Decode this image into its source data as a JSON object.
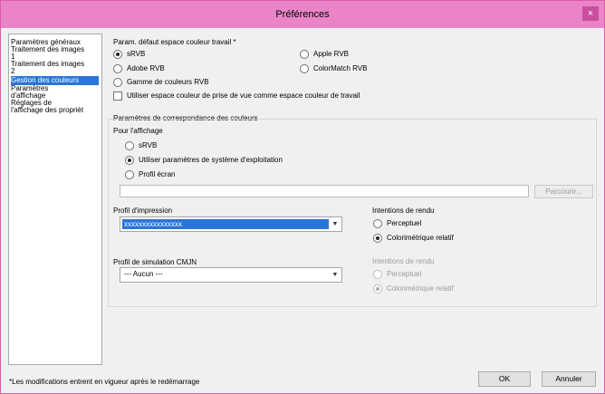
{
  "window": {
    "title": "Préférences",
    "close_glyph": "×"
  },
  "sidebar": {
    "items": [
      {
        "label": "Paramètres généraux",
        "selected": false
      },
      {
        "label": "Traitement des images",
        "selected": false
      },
      {
        "label": "1",
        "selected": false
      },
      {
        "label": "Traitement des images",
        "selected": false
      },
      {
        "label": "2",
        "selected": false
      },
      {
        "label": "Gestion des couleurs",
        "selected": true
      },
      {
        "label": "Paramètres",
        "selected": false
      },
      {
        "label": "d'affichage",
        "selected": false
      },
      {
        "label": "Réglages de",
        "selected": false
      },
      {
        "label": "l'affichage des propriét",
        "selected": false
      }
    ]
  },
  "workspace": {
    "title": "Param. défaut espace couleur travail *",
    "options": [
      {
        "label": "sRVB",
        "checked": true
      },
      {
        "label": "Apple RVB",
        "checked": false
      },
      {
        "label": "Adobe RVB",
        "checked": false
      },
      {
        "label": "ColorMatch RVB",
        "checked": false
      },
      {
        "label": "Gamme de couleurs RVB",
        "checked": false
      }
    ],
    "use_capture_space_label": "Utiliser espace couleur de prise de vue comme espace couleur de travail",
    "use_capture_space_checked": false
  },
  "matching": {
    "title": "Paramètres de correspondance des couleurs",
    "display_label": "Pour l'affichage",
    "display_options": [
      {
        "label": "sRVB",
        "checked": false
      },
      {
        "label": "Utiliser paramètres de système d'exploitation",
        "checked": true
      },
      {
        "label": "Profil écran",
        "checked": false
      }
    ],
    "profile_path": "",
    "browse_label": "Parcourir...",
    "print_profile_label": "Profil d'impression",
    "print_profile_value": "xxxxxxxxxxxxxxxx",
    "print_intent_label": "Intentions de rendu",
    "print_intents": [
      {
        "label": "Perceptuel",
        "checked": false
      },
      {
        "label": "Colorimétrique relatif",
        "checked": true
      }
    ],
    "cmyk_label": "Profil de simulation CMJN",
    "cmyk_value": "--- Aucun ---",
    "cmyk_intent_label": "Intentions de rendu",
    "cmyk_intents": [
      {
        "label": "Perceptuel",
        "checked": false
      },
      {
        "label": "Colorimétrique relatif",
        "checked": true
      }
    ],
    "combo_arrow": "▼"
  },
  "footer": {
    "note": "*Les modifications entrent en vigueur après le redémarrage",
    "ok_label": "OK",
    "cancel_label": "Annuler"
  },
  "colors": {
    "titlebar": "#ea84c7",
    "selection": "#2b74d8"
  }
}
